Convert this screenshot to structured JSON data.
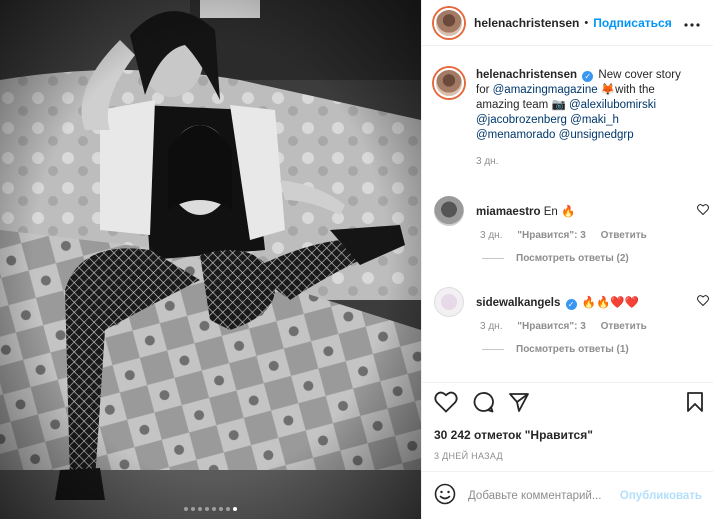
{
  "header": {
    "username": "helenachristensen",
    "separator": "•",
    "follow_label": "Подписаться",
    "more_icon": "more-horizontal-icon"
  },
  "caption": {
    "username": "helenachristensen",
    "verified_icon": "verified-badge-icon",
    "text_1": "New cover story for",
    "mention_1": "@amazingmagazine",
    "emoji_1": "🦊",
    "text_2": "with the amazing team",
    "emoji_2": "📷",
    "mention_2": "@alexilubomirski",
    "mention_3": "@jacobrozenberg",
    "mention_4": "@maki_h",
    "mention_5": "@menamorado",
    "mention_6": "@unsignedgrp",
    "time": "3 дн."
  },
  "comments": [
    {
      "username": "miamaestro",
      "text": "En 🔥",
      "time": "3 дн.",
      "likes": "\"Нравится\": 3",
      "reply": "Ответить",
      "replies": "Посмотреть ответы (2)"
    },
    {
      "username": "sidewalkangels",
      "text": "🔥🔥❤️❤️",
      "time": "3 дн.",
      "likes": "\"Нравится\": 3",
      "reply": "Ответить",
      "replies": "Посмотреть ответы (1)"
    }
  ],
  "likes": "30 242 отметок \"Нравится\"",
  "date": "3 ДНЕЙ НАЗАД",
  "comment_input": {
    "placeholder": "Добавьте комментарий...",
    "publish": "Опубликовать"
  },
  "carousel": {
    "count": 8,
    "active_index": 7
  },
  "colors": {
    "link": "#00376b",
    "accent": "#0095f6",
    "muted": "#8e8e8e"
  }
}
